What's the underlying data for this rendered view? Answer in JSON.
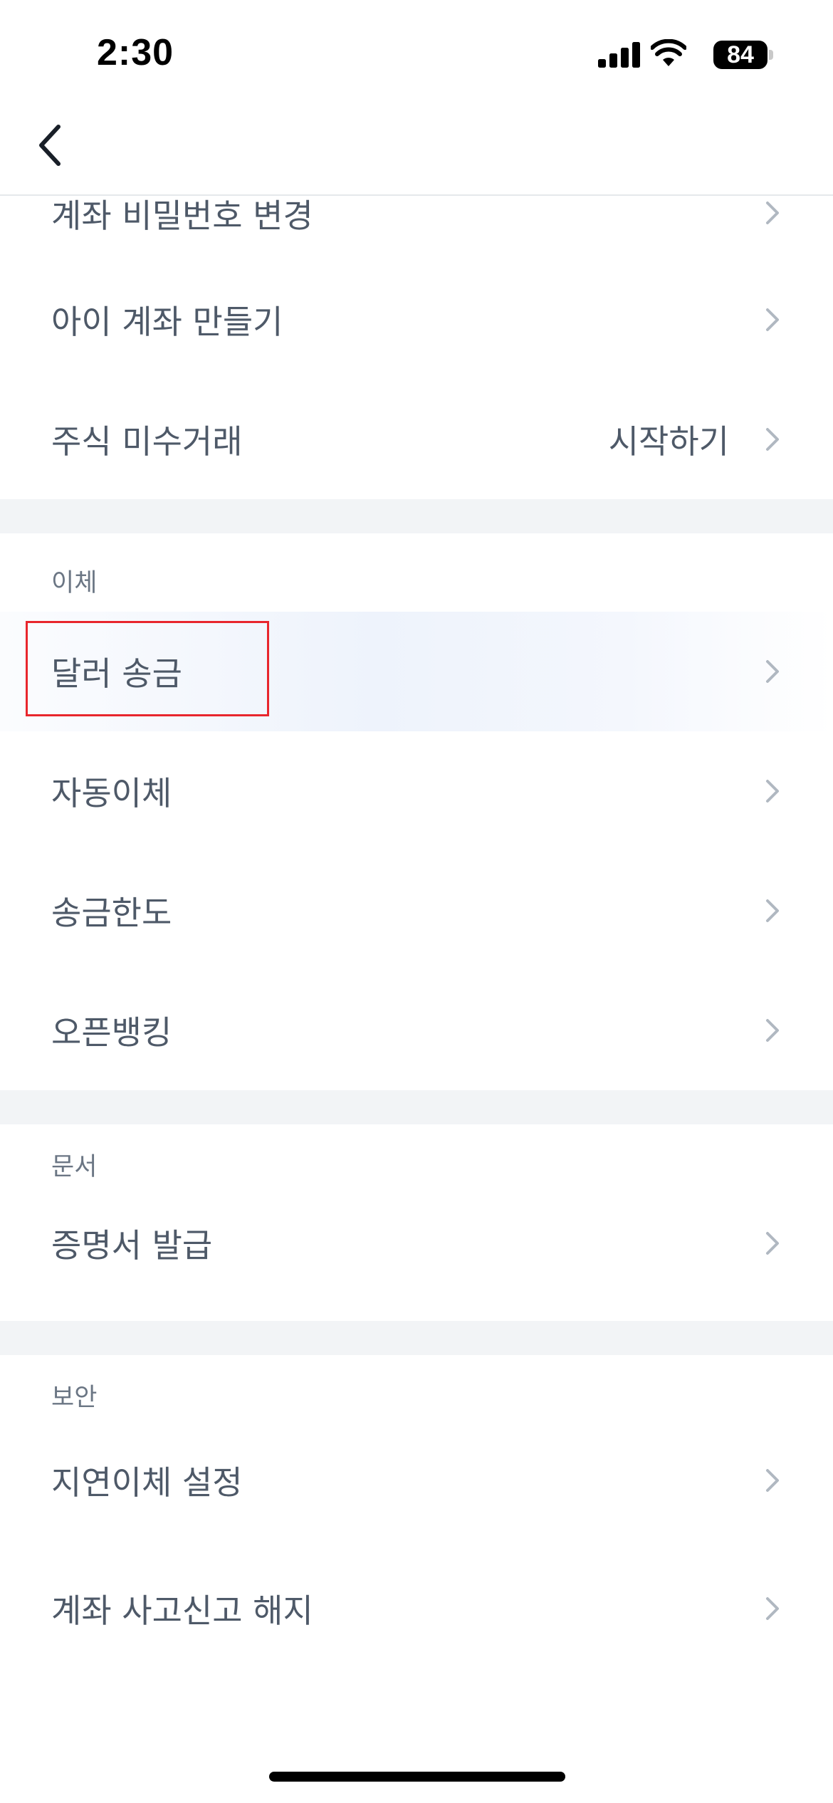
{
  "status_bar": {
    "time": "2:30",
    "battery_level": "84",
    "icons": [
      "cellular-signal-icon",
      "wifi-icon",
      "battery-icon"
    ]
  },
  "nav": {
    "back_icon": "chevron-left-icon"
  },
  "top_rows": [
    {
      "label": "계좌 비밀번호 변경",
      "value": ""
    },
    {
      "label": "아이 계좌 만들기",
      "value": ""
    },
    {
      "label": "주식 미수거래",
      "value": "시작하기"
    }
  ],
  "sections": [
    {
      "title": "이체",
      "rows": [
        {
          "label": "달러 송금",
          "highlighted": true
        },
        {
          "label": "자동이체"
        },
        {
          "label": "송금한도"
        },
        {
          "label": "오픈뱅킹"
        }
      ]
    },
    {
      "title": "문서",
      "rows": [
        {
          "label": "증명서 발급"
        }
      ]
    },
    {
      "title": "보안",
      "rows": [
        {
          "label": "지연이체 설정"
        },
        {
          "label": "계좌 사고신고 해지"
        }
      ]
    }
  ],
  "colors": {
    "text": "#4e5968",
    "section_title": "#6b7684",
    "chevron": "#b0b8c1",
    "separator": "#f2f4f6",
    "highlight_border": "#e8262d",
    "highlight_fill": "#eef3fc"
  }
}
